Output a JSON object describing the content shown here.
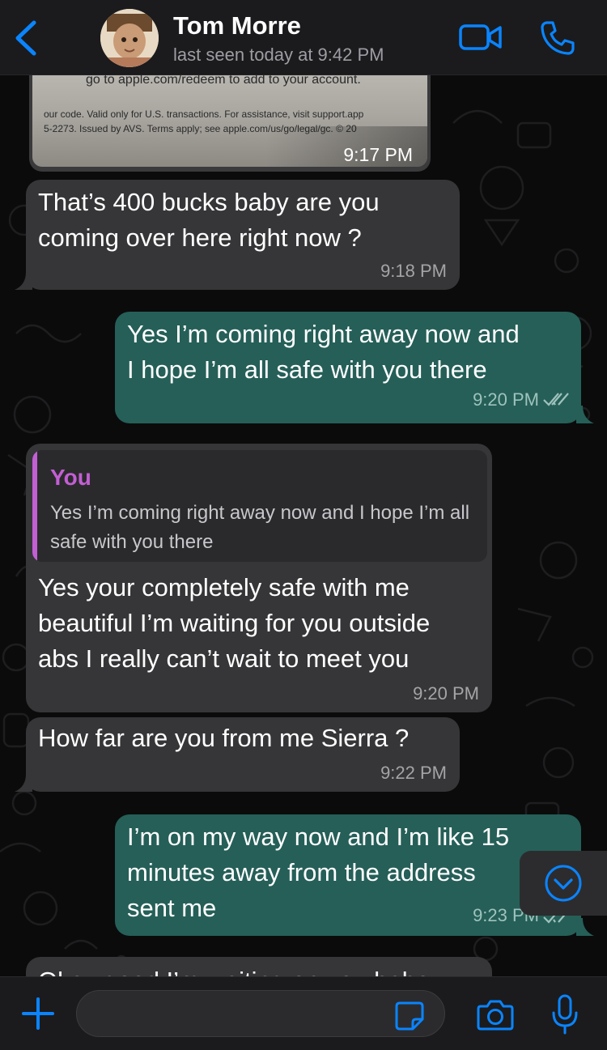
{
  "header": {
    "contact_name": "Tom Morre",
    "last_seen": "last seen today at 9:42 PM"
  },
  "image_message": {
    "caption_line1": "go to apple.com/redeem to add to your account.",
    "caption_line2": "our code. Valid only for U.S. transactions. For assistance, visit support.app",
    "caption_line3": "5-2273. Issued by AVS. Terms apply; see apple.com/us/go/legal/gc. © 20",
    "time": "9:17 PM"
  },
  "messages": [
    {
      "direction": "in",
      "text": "That’s 400 bucks baby are you\ncoming over here right now ?",
      "time": "9:18 PM"
    },
    {
      "direction": "out",
      "text": "Yes I’m coming right away now and\nI hope I’m all safe with you there",
      "time": "9:20 PM"
    },
    {
      "direction": "in",
      "quote_author": "You",
      "quote_text": "Yes I’m coming right away now and I hope I’m all safe with you there",
      "text": "Yes your completely safe with me\nbeautiful I’m waiting for you outside\nabs I really can’t wait to meet you",
      "time": "9:20 PM"
    },
    {
      "direction": "in",
      "text": "How far are you from me Sierra ?",
      "time": "9:22 PM"
    },
    {
      "direction": "out",
      "text": "I’m on my way now and I’m like 15\nminutes away from the address\nsent me",
      "time": "9:23 PM"
    },
    {
      "direction": "in",
      "text": "Okay good I’m waiting on you babe",
      "time": ""
    }
  ],
  "input": {
    "placeholder": "",
    "value": ""
  },
  "icons": {
    "back": "chevron-left-icon",
    "video": "video-camera-icon",
    "call": "phone-icon",
    "scroll": "chevron-down-circle-icon",
    "plus": "plus-icon",
    "sticker": "sticker-icon",
    "camera": "camera-icon",
    "mic": "microphone-icon"
  },
  "colors": {
    "accent": "#0a84ff",
    "outgoing_bubble": "#255f58",
    "incoming_bubble": "#363638",
    "quote_accent": "#c25fd3"
  }
}
